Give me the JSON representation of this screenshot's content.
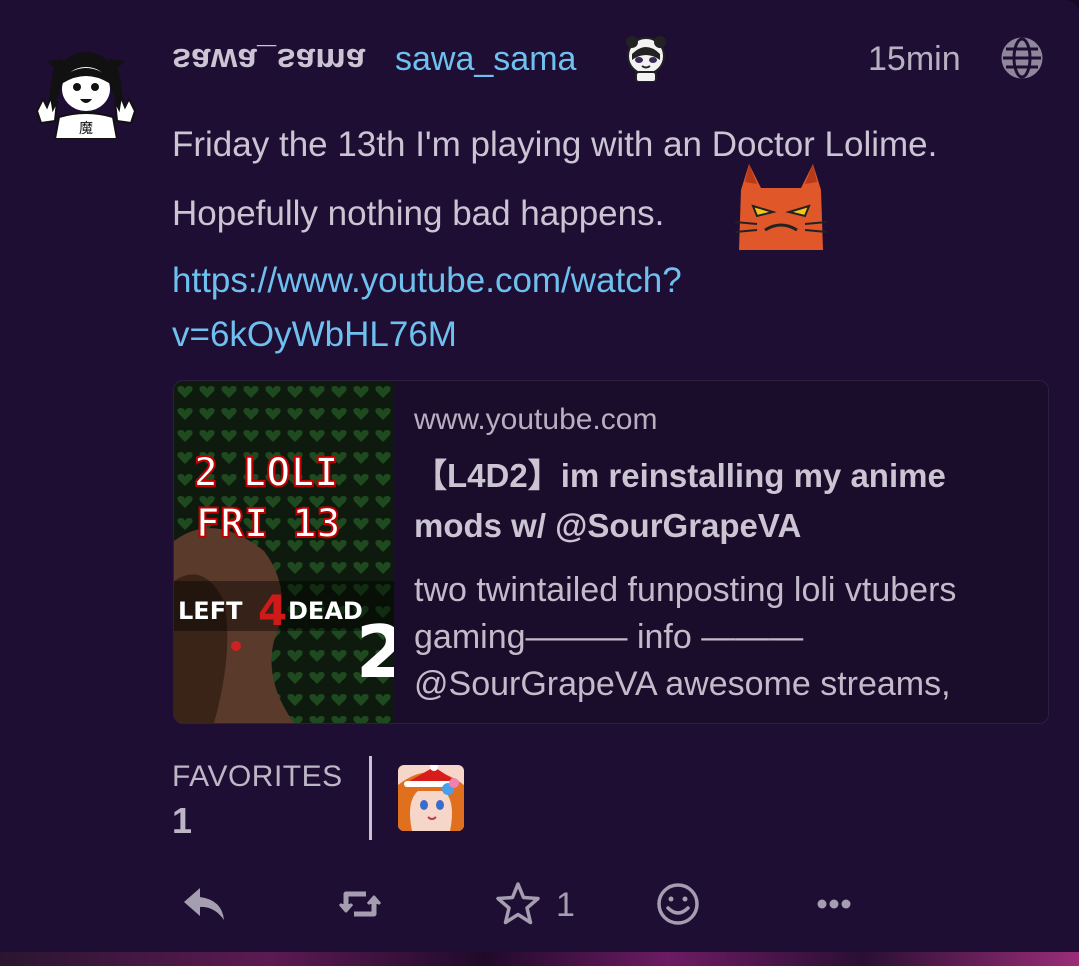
{
  "post": {
    "display_name": "sawa_sama",
    "username": "sawa_sama",
    "timestamp": "15min",
    "text_line1": "Friday the 13th I'm playing with an Doctor Lolime.",
    "text_line2": "Hopefully nothing bad happens.",
    "link_line1": "https://www.youtube.com/watch?",
    "link_line2": "v=6kOyWbHL76M"
  },
  "embed": {
    "host": "www.youtube.com",
    "title": "【L4D2】im reinstalling my anime mods w/ @SourGrapeVA",
    "description": "two twintailed funposting loli vtubers gaming——— info ——— @SourGrapeVA awesome streams,",
    "thumb_line1": "2 LOLI",
    "thumb_line2": "FRI 13",
    "thumb_logo_left": "LEFT",
    "thumb_logo_num": "4",
    "thumb_logo_right": "DEAD",
    "thumb_logo_two": "2"
  },
  "favorites": {
    "label": "FAVORITES",
    "count": "1"
  },
  "actions": {
    "star_count": "1",
    "icons": [
      "reply-icon",
      "boost-icon",
      "star-icon",
      "emoji-react-icon",
      "more-icon"
    ]
  },
  "colors": {
    "background": "#1f0e33",
    "link": "#6ec0ee",
    "text": "#cbc4d3",
    "muted": "#a59db0"
  }
}
